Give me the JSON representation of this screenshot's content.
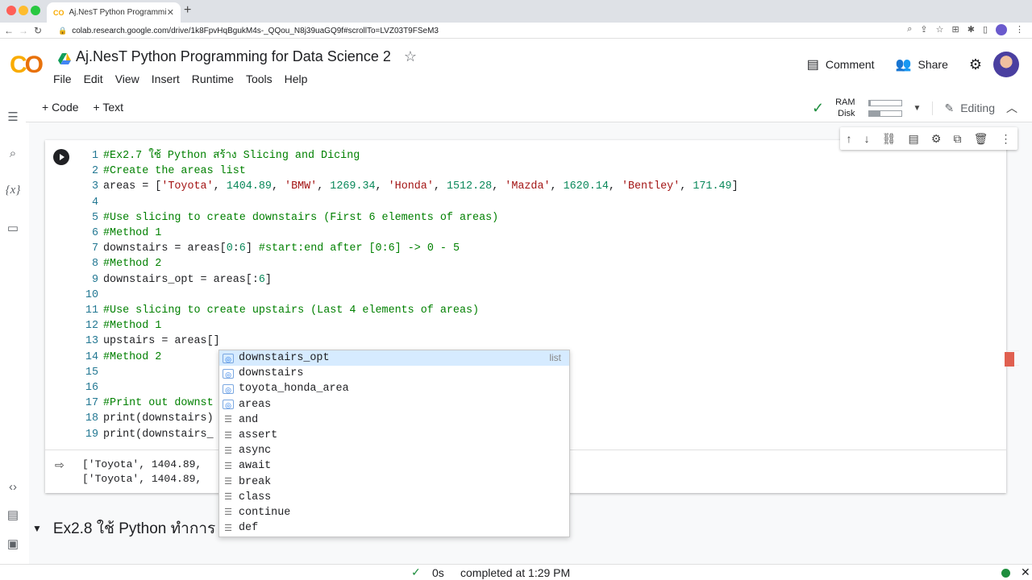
{
  "browser": {
    "tab_title": "Aj.NesT Python Programming f",
    "url": "colab.research.google.com/drive/1k8FpvHqBgukM4s-_QQou_N8j39uaGQ9f#scrollTo=LVZ03T9FSeM3"
  },
  "header": {
    "notebook_title": "Aj.NesT Python Programming for Data Science 2",
    "menu": [
      "File",
      "Edit",
      "View",
      "Insert",
      "Runtime",
      "Tools",
      "Help"
    ],
    "comment_label": "Comment",
    "share_label": "Share"
  },
  "toolbar": {
    "add_code": "+ Code",
    "add_text": "+ Text",
    "ram_label": "RAM",
    "disk_label": "Disk",
    "ram_usage": 0.05,
    "disk_usage": 0.35,
    "editing_label": "Editing"
  },
  "cell": {
    "lines": [
      {
        "n": "1",
        "segs": [
          {
            "t": "#Ex2.7 ใช้ Python สร้าง Slicing and Dicing",
            "c": "cmt"
          }
        ]
      },
      {
        "n": "2",
        "segs": [
          {
            "t": "#Create the areas list",
            "c": "cmt"
          }
        ]
      },
      {
        "n": "3",
        "segs": [
          {
            "t": "areas = [",
            "c": ""
          },
          {
            "t": "'Toyota'",
            "c": "str"
          },
          {
            "t": ", ",
            "c": ""
          },
          {
            "t": "1404.89",
            "c": "num"
          },
          {
            "t": ", ",
            "c": ""
          },
          {
            "t": "'BMW'",
            "c": "str"
          },
          {
            "t": ", ",
            "c": ""
          },
          {
            "t": "1269.34",
            "c": "num"
          },
          {
            "t": ", ",
            "c": ""
          },
          {
            "t": "'Honda'",
            "c": "str"
          },
          {
            "t": ", ",
            "c": ""
          },
          {
            "t": "1512.28",
            "c": "num"
          },
          {
            "t": ", ",
            "c": ""
          },
          {
            "t": "'Mazda'",
            "c": "str"
          },
          {
            "t": ", ",
            "c": ""
          },
          {
            "t": "1620.14",
            "c": "num"
          },
          {
            "t": ", ",
            "c": ""
          },
          {
            "t": "'Bentley'",
            "c": "str"
          },
          {
            "t": ", ",
            "c": ""
          },
          {
            "t": "171.49",
            "c": "num"
          },
          {
            "t": "]",
            "c": ""
          }
        ]
      },
      {
        "n": "4",
        "segs": []
      },
      {
        "n": "5",
        "segs": [
          {
            "t": "#Use slicing to create downstairs (First 6 elements of areas)",
            "c": "cmt"
          }
        ]
      },
      {
        "n": "6",
        "segs": [
          {
            "t": "#Method 1",
            "c": "cmt"
          }
        ]
      },
      {
        "n": "7",
        "segs": [
          {
            "t": "downstairs = areas[",
            "c": ""
          },
          {
            "t": "0",
            "c": "num"
          },
          {
            "t": ":",
            "c": ""
          },
          {
            "t": "6",
            "c": "num"
          },
          {
            "t": "] ",
            "c": ""
          },
          {
            "t": "#start:end after [0:6] -> 0 - 5",
            "c": "cmt"
          }
        ]
      },
      {
        "n": "8",
        "segs": [
          {
            "t": "#Method 2",
            "c": "cmt"
          }
        ]
      },
      {
        "n": "9",
        "segs": [
          {
            "t": "downstairs_opt = areas[:",
            "c": ""
          },
          {
            "t": "6",
            "c": "num"
          },
          {
            "t": "]",
            "c": ""
          }
        ]
      },
      {
        "n": "10",
        "segs": []
      },
      {
        "n": "11",
        "segs": [
          {
            "t": "#Use slicing to create upstairs (Last 4 elements of areas)",
            "c": "cmt"
          }
        ]
      },
      {
        "n": "12",
        "segs": [
          {
            "t": "#Method 1",
            "c": "cmt"
          }
        ]
      },
      {
        "n": "13",
        "segs": [
          {
            "t": "upstairs = areas[]",
            "c": ""
          }
        ]
      },
      {
        "n": "14",
        "segs": [
          {
            "t": "#Method 2",
            "c": "cmt"
          }
        ]
      },
      {
        "n": "15",
        "segs": []
      },
      {
        "n": "16",
        "segs": []
      },
      {
        "n": "17",
        "segs": [
          {
            "t": "#Print out downst",
            "c": "cmt"
          }
        ]
      },
      {
        "n": "18",
        "segs": [
          {
            "t": "print(downstairs)",
            "c": ""
          }
        ]
      },
      {
        "n": "19",
        "segs": [
          {
            "t": "print(downstairs_",
            "c": ""
          }
        ]
      }
    ],
    "output": [
      "['Toyota', 1404.89,",
      "['Toyota', 1404.89,"
    ]
  },
  "autocomplete": {
    "items": [
      {
        "label": "downstairs_opt",
        "kind": "var",
        "type": "list"
      },
      {
        "label": "downstairs",
        "kind": "var",
        "type": ""
      },
      {
        "label": "toyota_honda_area",
        "kind": "var",
        "type": ""
      },
      {
        "label": "areas",
        "kind": "var",
        "type": ""
      },
      {
        "label": "and",
        "kind": "kw",
        "type": ""
      },
      {
        "label": "assert",
        "kind": "kw",
        "type": ""
      },
      {
        "label": "async",
        "kind": "kw",
        "type": ""
      },
      {
        "label": "await",
        "kind": "kw",
        "type": ""
      },
      {
        "label": "break",
        "kind": "kw",
        "type": ""
      },
      {
        "label": "class",
        "kind": "kw",
        "type": ""
      },
      {
        "label": "continue",
        "kind": "kw",
        "type": ""
      },
      {
        "label": "def",
        "kind": "kw",
        "type": ""
      }
    ]
  },
  "next_section": {
    "title": "Ex2.8 ใช้ Python ทำการ"
  },
  "status": {
    "duration": "0s",
    "text": "completed at 1:29 PM"
  },
  "colors": {
    "accent": "#f9ab00",
    "comment": "#008000",
    "string": "#a31515",
    "number": "#09885a"
  }
}
